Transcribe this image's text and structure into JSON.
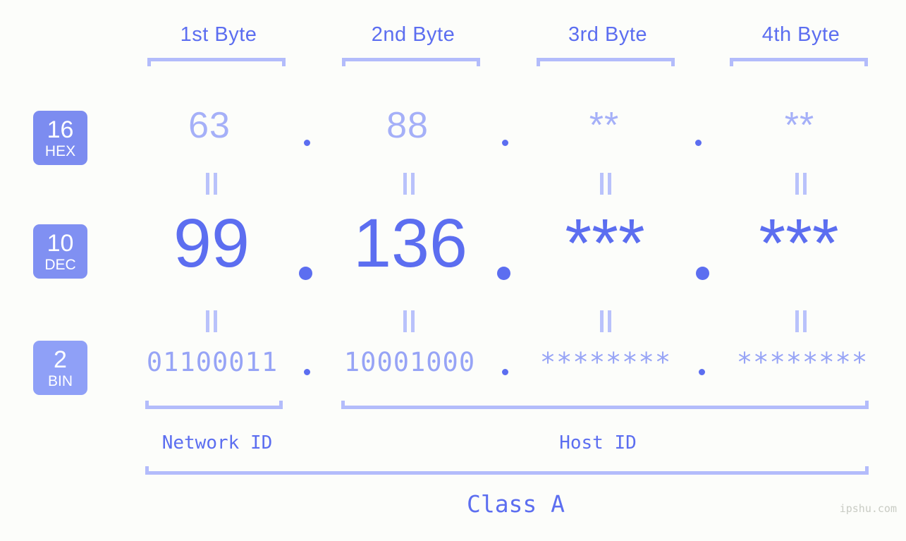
{
  "meta": {
    "background_color": "#fcfdfa",
    "accent_color": "#5c6ef0",
    "accent_light_color": "#a5b0f8",
    "bracket_color": "#b3bcfb",
    "watermark": "ipshu.com"
  },
  "byte_headers": [
    {
      "label": "1st Byte"
    },
    {
      "label": "2nd Byte"
    },
    {
      "label": "3rd Byte"
    },
    {
      "label": "4th Byte"
    }
  ],
  "bases": [
    {
      "num": "16",
      "name": "HEX",
      "color": "#7c8cf0"
    },
    {
      "num": "10",
      "name": "DEC",
      "color": "#8090f2"
    },
    {
      "num": "2",
      "name": "BIN",
      "color": "#8fa0f7"
    }
  ],
  "rows": {
    "hex": {
      "base_num": "16",
      "base_name": "HEX",
      "values": [
        "63",
        "88",
        "**",
        "**"
      ],
      "separators": [
        ".",
        ".",
        "."
      ]
    },
    "dec": {
      "base_num": "10",
      "base_name": "DEC",
      "values": [
        "99",
        "136",
        "***",
        "***"
      ],
      "separators": [
        ".",
        ".",
        "."
      ]
    },
    "bin": {
      "base_num": "2",
      "base_name": "BIN",
      "values": [
        "01100011",
        "10001000",
        "********",
        "********"
      ],
      "separators": [
        ".",
        ".",
        "."
      ]
    }
  },
  "equality_marks": {
    "symbol": "||",
    "hex_to_dec_count": 4,
    "dec_to_bin_count": 4
  },
  "segments": {
    "network_id": {
      "label": "Network ID"
    },
    "host_id": {
      "label": "Host ID"
    },
    "class": {
      "label": "Class A"
    }
  }
}
